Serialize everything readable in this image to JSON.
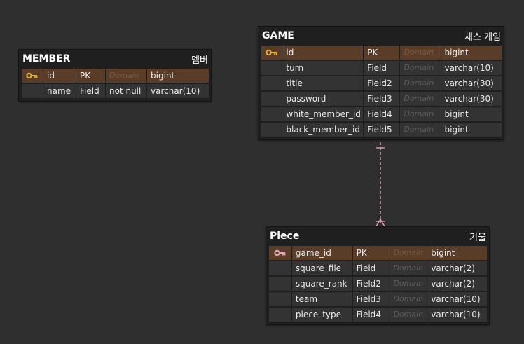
{
  "tables": {
    "member": {
      "name": "MEMBER",
      "korean": "멤버",
      "rows": [
        {
          "field": "id",
          "kind": "PK",
          "constraint": "Domain",
          "type": "bigint",
          "pk": true
        },
        {
          "field": "name",
          "kind": "Field",
          "constraint": "not null",
          "type": "varchar(10)"
        }
      ]
    },
    "game": {
      "name": "GAME",
      "korean": "체스 게임",
      "rows": [
        {
          "field": "id",
          "kind": "PK",
          "constraint": "Domain",
          "type": "bigint",
          "pk": true
        },
        {
          "field": "turn",
          "kind": "Field",
          "constraint": "Domain",
          "type": "varchar(10)"
        },
        {
          "field": "title",
          "kind": "Field2",
          "constraint": "Domain",
          "type": "varchar(30)"
        },
        {
          "field": "password",
          "kind": "Field3",
          "constraint": "Domain",
          "type": "varchar(30)"
        },
        {
          "field": "white_member_id",
          "kind": "Field4",
          "constraint": "Domain",
          "type": "bigint"
        },
        {
          "field": "black_member_id",
          "kind": "Field5",
          "constraint": "Domain",
          "type": "bigint"
        }
      ]
    },
    "piece": {
      "name": "Piece",
      "korean": "기물",
      "rows": [
        {
          "field": "game_id",
          "kind": "PK",
          "constraint": "Domain",
          "type": "bigint",
          "pk": true,
          "fk": true
        },
        {
          "field": "square_file",
          "kind": "Field",
          "constraint": "Domain",
          "type": "varchar(2)"
        },
        {
          "field": "square_rank",
          "kind": "Field2",
          "constraint": "Domain",
          "type": "varchar(2)"
        },
        {
          "field": "team",
          "kind": "Field3",
          "constraint": "Domain",
          "type": "varchar(10)"
        },
        {
          "field": "piece_type",
          "kind": "Field4",
          "constraint": "Domain",
          "type": "varchar(10)"
        }
      ]
    }
  },
  "relationship": {
    "from": "game",
    "to": "piece",
    "from_end": "one",
    "to_end": "many",
    "color": "#e8a7b6"
  },
  "colors": {
    "background": "#2f2f2f",
    "pk_row": "#5a3d28",
    "pk_key": "#e2b33c",
    "fk_key": "#e8a7b6",
    "cell": "#333333"
  }
}
